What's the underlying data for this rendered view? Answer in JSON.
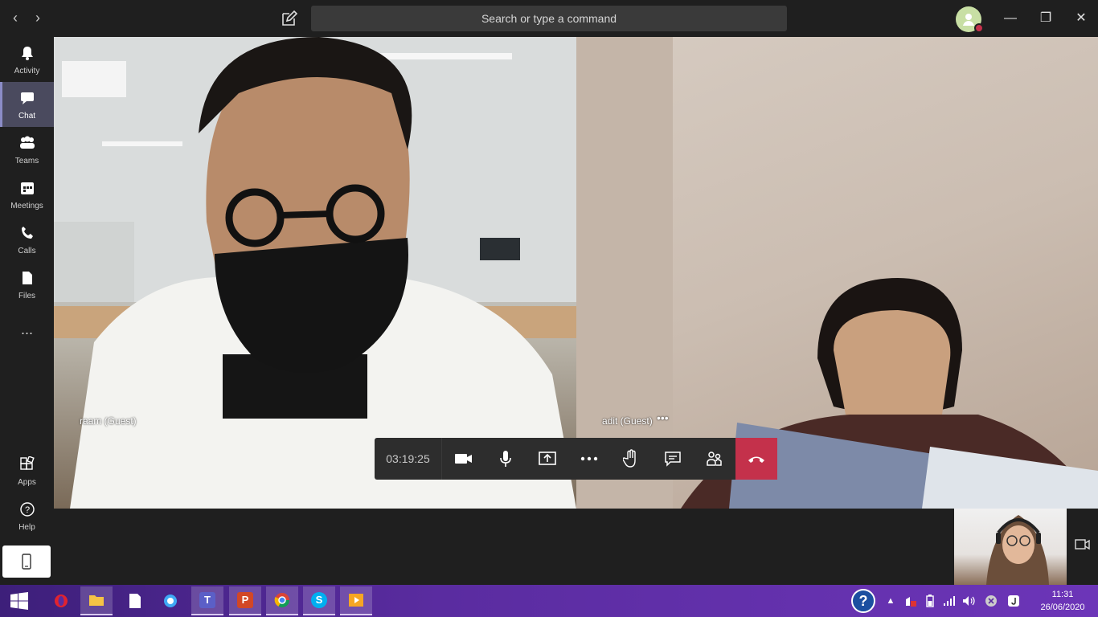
{
  "search": {
    "placeholder": "Search or type a command"
  },
  "rail": {
    "items": [
      {
        "label": "Activity"
      },
      {
        "label": "Chat"
      },
      {
        "label": "Teams"
      },
      {
        "label": "Meetings"
      },
      {
        "label": "Calls"
      },
      {
        "label": "Files"
      },
      {
        "label": "..."
      }
    ],
    "apps_label": "Apps",
    "help_label": "Help"
  },
  "participants": [
    {
      "name": "raam (Guest)"
    },
    {
      "name": "adit (Guest)"
    }
  ],
  "call": {
    "timer": "03:19:25"
  },
  "taskbar": {
    "time": "11:31",
    "date": "26/06/2020",
    "ppt_label": "P",
    "teams_label": "T",
    "skype_label": "S"
  }
}
